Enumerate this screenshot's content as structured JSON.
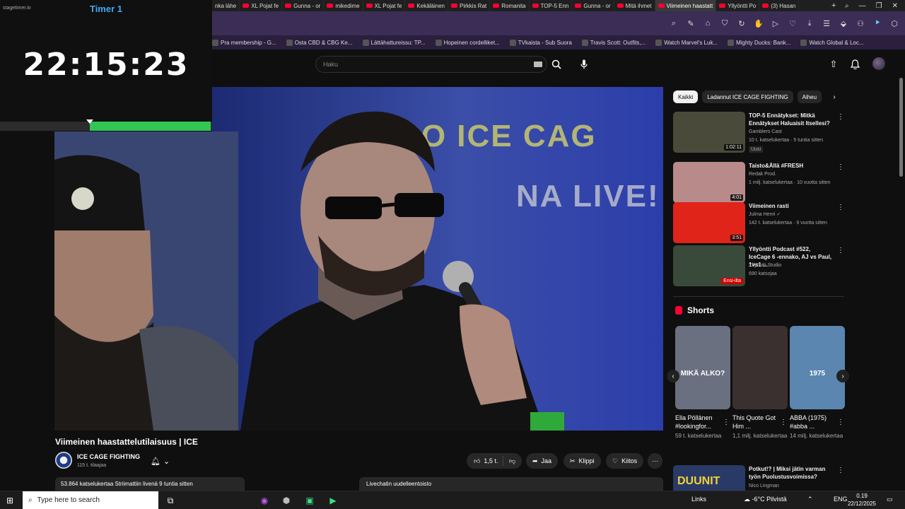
{
  "browser": {
    "tabs": [
      {
        "label": "nka lähe",
        "yt": false
      },
      {
        "label": "XL Pojat fe",
        "yt": true
      },
      {
        "label": "Gunna - or",
        "yt": true
      },
      {
        "label": "mikedime",
        "yt": true
      },
      {
        "label": "XL Pojat fe",
        "yt": true
      },
      {
        "label": "Kekäläinen",
        "yt": true
      },
      {
        "label": "Pirkkis Rat",
        "yt": true
      },
      {
        "label": "Romanita",
        "yt": true
      },
      {
        "label": "TOP-5 Enn",
        "yt": true
      },
      {
        "label": "Gunna - or",
        "yt": true
      },
      {
        "label": "Mitä ihmet",
        "yt": true
      },
      {
        "label": "Viimeinen haastatt",
        "yt": true,
        "active": true
      },
      {
        "label": "Yllyöntti Po",
        "yt": true
      },
      {
        "label": "(3) Hasan",
        "yt": true
      }
    ],
    "new_tab_symbol": "+",
    "bookmarks": [
      "Pra membership - G...",
      "Osta CBD & CBG Ke...",
      "Lättähattureissu: TP...",
      "Hopeinen cordelliket...",
      "TVkaista - Sub Suora",
      "Travis Scott: Outfits,...",
      "Watch Marvel's Luk...",
      "Mighty Ducks: Bank...",
      "Watch Global & Loc..."
    ]
  },
  "timer": {
    "logo": "stagetimer.io",
    "label": "Timer 1",
    "time": "22:15:23",
    "progress_fraction": 0.57,
    "marker_fraction": 0.423
  },
  "youtube": {
    "search_placeholder": "Haku",
    "video": {
      "title": "Viimeinen haastattelutilaisuus | ICE",
      "channel": "ICE CAGE FIGHTING",
      "subscribers": "115 t. tilaajaa",
      "likes": "1,5 t.",
      "share": "Jaa",
      "clip": "Klippi",
      "thanks": "Kiitos",
      "description": "53.864 katselukertaa  Striimattiin livenä 9 tuntia sitten",
      "chat_replay": "Livechatin uudelleentoisto",
      "banner_text": "LTSO ICE CAG",
      "banner_text2": "NA LIVE!"
    },
    "chips": [
      "Kaikki",
      "Ladannut ICE CAGE FIGHTING",
      "Aiheu"
    ],
    "recommendations": [
      {
        "title": "TOP-5 Ennätykset: Mitkä Ennätykset Haluaisit Itsellesi?",
        "channel": "Gamblers Cast",
        "meta": "10 t. katselukertaa · 5 tuntia sitten",
        "badge": "Uusi",
        "duration": "1:02:11",
        "thumb_color": "#4a4a3a"
      },
      {
        "title": "Taisto&Ällä #FRESH",
        "channel": "Redak Prod.",
        "meta": "1 milj. katselukertaa · 10 vuotta sitten",
        "badge": "",
        "duration": "4:01",
        "thumb_color": "#b98a8a"
      },
      {
        "title": "Viimeinen rasti",
        "channel": "Julma Henri ✓",
        "meta": "142 t. katselukertaa · 9 vuotta sitten",
        "badge": "",
        "duration": "3:51",
        "thumb_color": "#e0241a"
      },
      {
        "title": "Yllyöntti Podcast #522, IceCage 6 -ennako, AJ vs Paul, 1vs1 ...",
        "channel": "Yllyöntti Studio",
        "meta": "690 katsojaa",
        "badge": "",
        "live": "Ensi-ilta",
        "thumb_color": "#3a4a3a"
      }
    ],
    "shorts_header": "Shorts",
    "shorts": [
      {
        "title": "Ella Pöllänen #lookingfor...",
        "views": "59 t. katselukertaa",
        "thumb_color": "#6a7080",
        "overlay": "MIKÄ ALKO?"
      },
      {
        "title": "This Quote Got Him ...",
        "views": "1,1 milj. katselukertaa",
        "thumb_color": "#3a3030",
        "overlay": ""
      },
      {
        "title": "ABBA (1975) #abba ...",
        "views": "14 milj. katselukertaa",
        "thumb_color": "#5a86b0",
        "overlay": "1975"
      }
    ],
    "bottom_rec": {
      "title": "Potkut!? | Miksi jätin varman työn Puolustusvoimissa?",
      "channel": "Nico Lingman",
      "thumb_text": "DUUNIT"
    }
  },
  "taskbar": {
    "search_placeholder": "Type here to search",
    "links": "Links",
    "weather": "-6°C  Pilvistä",
    "lang": "ENG",
    "time": "0.19",
    "date": "22/12/2025"
  }
}
